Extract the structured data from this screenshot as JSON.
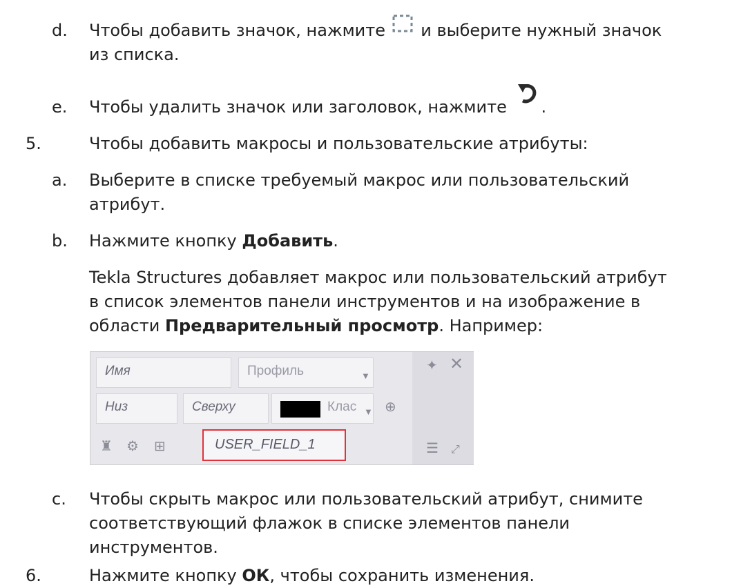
{
  "steps": [
    {
      "marker": "d.",
      "line1_pre": "Чтобы добавить значок, нажмите ",
      "line1_post": " и выберите нужный значок",
      "line2": "из списка.",
      "icon": "dashed-square-icon"
    },
    {
      "marker": "e.",
      "text_pre": "Чтобы удалить значок или заголовок, нажмите ",
      "text_post": ".",
      "icon": "undo-arrow-icon"
    },
    {
      "marker": "5.",
      "text": "Чтобы добавить макросы и пользовательские атрибуты:"
    },
    {
      "marker": "a.",
      "line1": "Выберите в списке требуемый макрос или пользовательский",
      "line2": "атрибут."
    },
    {
      "marker": "b.",
      "pre": "Нажмите кнопку ",
      "bold": "Добавить",
      "post": "."
    },
    {
      "para_line1": "Tekla Structures добавляет макрос или пользовательский атрибут",
      "para_line2": "в список элементов панели инструментов и на изображение в",
      "para_line3_pre": "области ",
      "para_line3_bold": "Предварительный просмотр",
      "para_line3_post": ". Например:"
    },
    {
      "marker": "c.",
      "line1": "Чтобы скрыть макрос или пользовательский атрибут, снимите",
      "line2": "соответствующий флажок в списке элементов панели",
      "line3": "инструментов."
    },
    {
      "marker": "6.",
      "pre": "Нажмите кнопку ",
      "bold": "ОК",
      "post": ", чтобы сохранить изменения."
    }
  ],
  "preview": {
    "name_field": "Имя",
    "profile_field": "Профиль",
    "bottom_field": "Низ",
    "top_field": "Сверху",
    "class_field": "Клас",
    "user_field": "USER_FIELD_1",
    "icons": [
      "pin-icon",
      "close-icon",
      "move-icon",
      "brush-icon",
      "eye-icon",
      "cube-icon",
      "list-icon",
      "expand-icon"
    ],
    "highlight_color": "#e0323a"
  }
}
